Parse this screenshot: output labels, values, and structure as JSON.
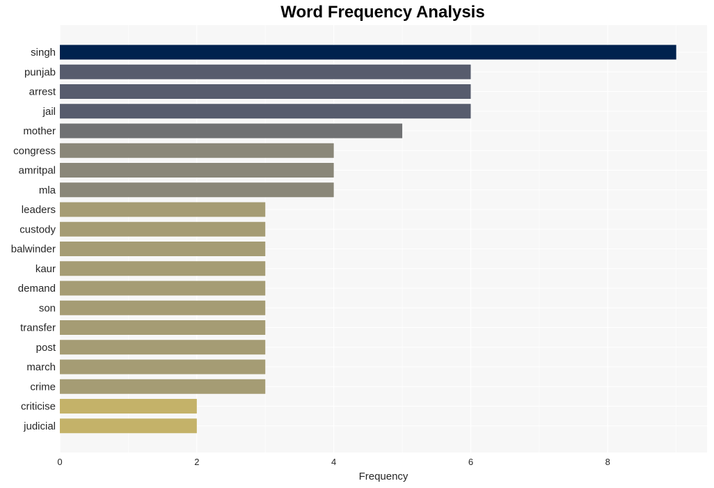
{
  "chart_data": {
    "type": "bar",
    "orientation": "horizontal",
    "title": "Word Frequency Analysis",
    "xlabel": "Frequency",
    "ylabel": "",
    "xlim": [
      0,
      9.45
    ],
    "xticks": [
      0,
      2,
      4,
      6,
      8
    ],
    "grid": true,
    "categories": [
      "singh",
      "punjab",
      "arrest",
      "jail",
      "mother",
      "congress",
      "amritpal",
      "mla",
      "leaders",
      "custody",
      "balwinder",
      "kaur",
      "demand",
      "son",
      "transfer",
      "post",
      "march",
      "crime",
      "criticise",
      "judicial"
    ],
    "values": [
      9,
      6,
      6,
      6,
      5,
      4,
      4,
      4,
      3,
      3,
      3,
      3,
      3,
      3,
      3,
      3,
      3,
      3,
      2,
      2
    ],
    "colors": {
      "9": "#00224e",
      "6": "#575c6d",
      "5": "#707173",
      "4": "#8a8779",
      "3": "#a59c74",
      "2": "#c4b269"
    },
    "background": "#f7f7f7",
    "gridline_color": "#ffffff"
  }
}
